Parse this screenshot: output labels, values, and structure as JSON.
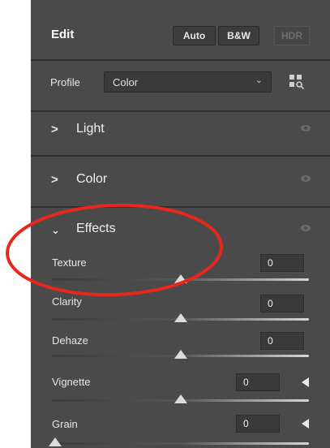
{
  "header": {
    "title": "Edit",
    "buttons": [
      {
        "label": "Auto",
        "enabled": true
      },
      {
        "label": "B&W",
        "enabled": true
      },
      {
        "label": "HDR",
        "enabled": false
      }
    ]
  },
  "profile": {
    "label": "Profile",
    "value": "Color",
    "browse_icon": "profile-browser-grid-icon"
  },
  "sections": {
    "light": {
      "title": "Light",
      "expanded": false
    },
    "color": {
      "title": "Color",
      "expanded": false
    },
    "effects": {
      "title": "Effects",
      "expanded": true
    }
  },
  "sliders": [
    {
      "label": "Texture",
      "value": "0",
      "position": 0.5
    },
    {
      "label": "Clarity",
      "value": "0",
      "position": 0.5
    },
    {
      "label": "Dehaze",
      "value": "0",
      "position": 0.5
    },
    {
      "label": "Vignette",
      "value": "0",
      "position": 0.5
    },
    {
      "label": "Grain",
      "value": "0",
      "position": 0.0
    }
  ],
  "colors": {
    "panel_bg": "#4a4a4a",
    "annotation": "#e8261c"
  }
}
